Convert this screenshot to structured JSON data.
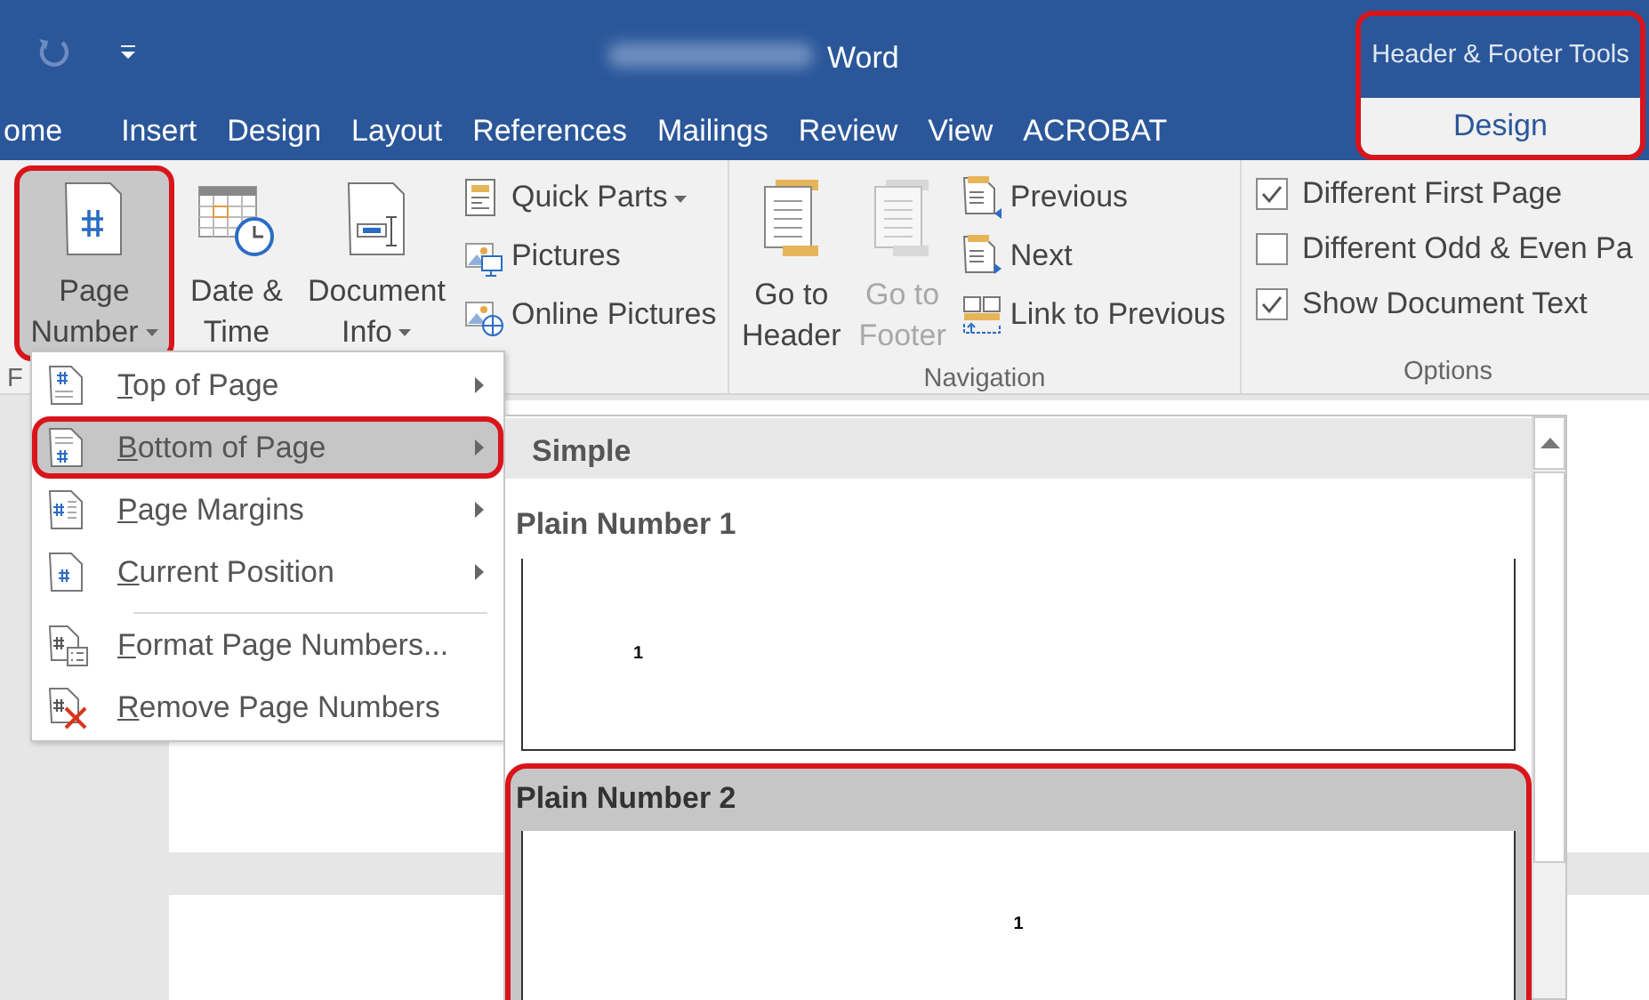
{
  "title_bar": {
    "title": "Word"
  },
  "contextual_group": {
    "label": "Header & Footer Tools",
    "outlined": true,
    "tab": {
      "label": "Design",
      "selected": true
    }
  },
  "tabs": [
    {
      "label": "ome",
      "selected": false
    },
    {
      "label": "Insert",
      "selected": false
    },
    {
      "label": "Design",
      "selected": false
    },
    {
      "label": "Layout",
      "selected": false
    },
    {
      "label": "References",
      "selected": false
    },
    {
      "label": "Mailings",
      "selected": false
    },
    {
      "label": "Review",
      "selected": false
    },
    {
      "label": "View",
      "selected": false
    },
    {
      "label": "ACROBAT",
      "selected": false
    }
  ],
  "insert_group": {
    "label": "F",
    "large_buttons": [
      {
        "lines": [
          "Page",
          "Number"
        ],
        "dropdown": true,
        "pressed": true,
        "outlined": true,
        "kind": "page-number"
      },
      {
        "lines": [
          "Date &",
          "Time"
        ],
        "dropdown": false,
        "pressed": false,
        "outlined": false,
        "kind": "date-time"
      },
      {
        "lines": [
          "Document",
          "Info"
        ],
        "dropdown": true,
        "pressed": false,
        "outlined": false,
        "kind": "document-info"
      }
    ],
    "small_buttons": [
      {
        "label": "Quick Parts",
        "dropdown": true,
        "kind": "quick-parts"
      },
      {
        "label": "Pictures",
        "dropdown": false,
        "kind": "pictures"
      },
      {
        "label": "Online Pictures",
        "dropdown": false,
        "kind": "online-pictures"
      }
    ]
  },
  "navigation_group": {
    "label": "Navigation",
    "large_buttons": [
      {
        "lines": [
          "Go to",
          "Header"
        ],
        "disabled": false
      },
      {
        "lines": [
          "Go to",
          "Footer"
        ],
        "disabled": true
      }
    ],
    "small_buttons": [
      {
        "label": "Previous",
        "kind": "previous"
      },
      {
        "label": "Next",
        "kind": "next"
      },
      {
        "label": "Link to Previous",
        "kind": "link"
      }
    ]
  },
  "options_group": {
    "label": "Options",
    "checkboxes": [
      {
        "label": "Different First Page",
        "checked": true
      },
      {
        "label": "Different Odd & Even Pa",
        "checked": false
      },
      {
        "label": "Show Document Text",
        "checked": true
      }
    ]
  },
  "page_number_menu": [
    {
      "label": "Top of Page",
      "submenu": true,
      "selected": false,
      "outlined": false,
      "separator_before": false,
      "kind": "top"
    },
    {
      "label": "Bottom of Page",
      "submenu": true,
      "selected": true,
      "outlined": true,
      "separator_before": false,
      "kind": "bottom"
    },
    {
      "label": "Page Margins",
      "submenu": true,
      "selected": false,
      "outlined": false,
      "separator_before": false,
      "kind": "margins"
    },
    {
      "label": "Current Position",
      "submenu": true,
      "selected": false,
      "outlined": false,
      "separator_before": false,
      "kind": "current"
    },
    {
      "label": "Format Page Numbers...",
      "submenu": false,
      "selected": false,
      "outlined": false,
      "separator_before": true,
      "kind": "format"
    },
    {
      "label": "Remove Page Numbers",
      "submenu": false,
      "selected": false,
      "outlined": false,
      "separator_before": false,
      "kind": "remove"
    }
  ],
  "gallery": {
    "section": "Simple",
    "items": [
      {
        "label": "Plain Number 1",
        "number": "1",
        "kind": "left",
        "selected": false,
        "outlined": false
      },
      {
        "label": "Plain Number 2",
        "number": "1",
        "kind": "center",
        "selected": true,
        "outlined": true
      }
    ]
  }
}
